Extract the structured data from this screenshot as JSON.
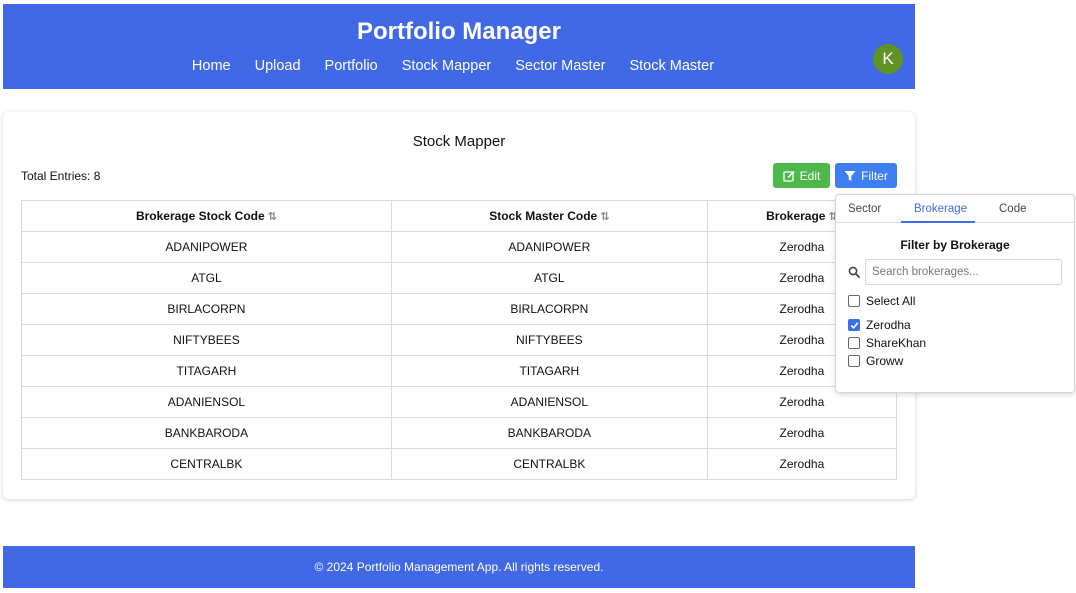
{
  "header": {
    "title": "Portfolio Manager",
    "nav": [
      "Home",
      "Upload",
      "Portfolio",
      "Stock Mapper",
      "Sector Master",
      "Stock Master"
    ],
    "avatar_letter": "K",
    "color": "#4169e6",
    "avatar_color": "#5f9424"
  },
  "page": {
    "title": "Stock Mapper",
    "total_entries": "Total Entries: 8",
    "edit_label": "Edit",
    "filter_label": "Filter"
  },
  "table": {
    "columns": [
      "Brokerage Stock Code",
      "Stock Master Code",
      "Brokerage"
    ],
    "rows": [
      [
        "ADANIPOWER",
        "ADANIPOWER",
        "Zerodha"
      ],
      [
        "ATGL",
        "ATGL",
        "Zerodha"
      ],
      [
        "BIRLACORPN",
        "BIRLACORPN",
        "Zerodha"
      ],
      [
        "NIFTYBEES",
        "NIFTYBEES",
        "Zerodha"
      ],
      [
        "TITAGARH",
        "TITAGARH",
        "Zerodha"
      ],
      [
        "ADANIENSOL",
        "ADANIENSOL",
        "Zerodha"
      ],
      [
        "BANKBARODA",
        "BANKBARODA",
        "Zerodha"
      ],
      [
        "CENTRALBK",
        "CENTRALBK",
        "Zerodha"
      ]
    ]
  },
  "filter_popover": {
    "tabs": [
      "Sector",
      "Brokerage",
      "Code"
    ],
    "active_tab": "Brokerage",
    "heading": "Filter by Brokerage",
    "search_placeholder": "Search brokerages...",
    "options": [
      {
        "label": "Select All",
        "checked": false
      },
      {
        "label": "Zerodha",
        "checked": true
      },
      {
        "label": "ShareKhan",
        "checked": false
      },
      {
        "label": "Groww",
        "checked": false
      }
    ]
  },
  "footer": {
    "text": "© 2024 Portfolio Management App. All rights reserved."
  },
  "colors": {
    "edit_button": "#4fb84c",
    "filter_button": "#3d7ff0",
    "accent": "#3d6fe8"
  }
}
